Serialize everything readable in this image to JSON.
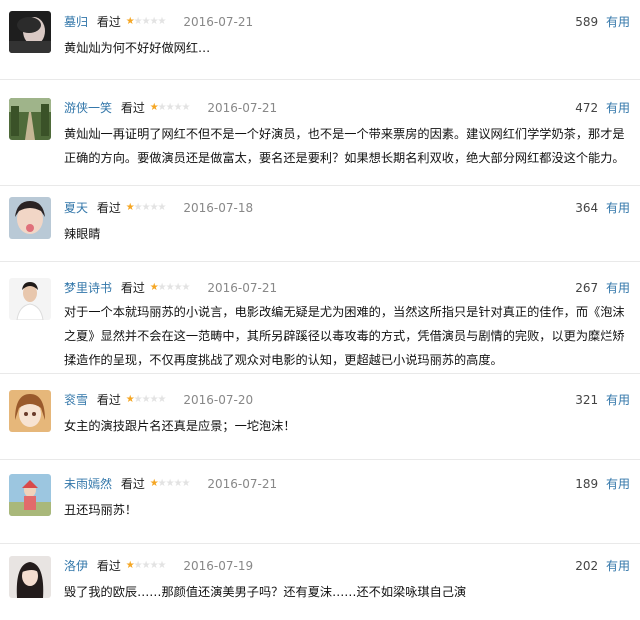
{
  "reviews": [
    {
      "user": "墓归",
      "status": "看过",
      "rating": 1,
      "date": "2016-07-21",
      "votes": "589",
      "useful_label": "有用",
      "avatar_icon": "dark-portrait-avatar",
      "content": "黄灿灿为何不好好做网红…"
    },
    {
      "user": "游侠一笑",
      "status": "看过",
      "rating": 1,
      "date": "2016-07-21",
      "votes": "472",
      "useful_label": "有用",
      "avatar_icon": "forest-road-avatar",
      "content": "黄灿灿一再证明了网红不但不是一个好演员，也不是一个带来票房的因素。建议网红们学学奶茶，那才是正确的方向。要做演员还是做富太，要名还是要利？如果想长期名利双收，绝大部分网红都没这个能力。"
    },
    {
      "user": "夏天",
      "status": "看过",
      "rating": 1,
      "date": "2016-07-18",
      "votes": "364",
      "useful_label": "有用",
      "avatar_icon": "girl-tongue-avatar",
      "content": "辣眼睛"
    },
    {
      "user": "梦里诗书",
      "status": "看过",
      "rating": 1,
      "date": "2016-07-21",
      "votes": "267",
      "useful_label": "有用",
      "avatar_icon": "man-white-shirt-avatar",
      "content": "对于一个本就玛丽苏的小说言，电影改编无疑是尤为困难的，当然这所指只是针对真正的佳作，而《泡沫之夏》显然并不会在这一范畴中，其所另辟蹊径以毒攻毒的方式，凭借演员与剧情的完败，以更为糜烂矫揉造作的呈现，不仅再度挑战了观众对电影的认知，更超越已小说玛丽苏的高度。"
    },
    {
      "user": "衮雪",
      "status": "看过",
      "rating": 1,
      "date": "2016-07-20",
      "votes": "321",
      "useful_label": "有用",
      "avatar_icon": "anime-girl-avatar",
      "content": "女主的演技跟片名还真是应景；一坨泡沫！"
    },
    {
      "user": "未雨嫣然",
      "status": "看过",
      "rating": 1,
      "date": "2016-07-21",
      "votes": "189",
      "useful_label": "有用",
      "avatar_icon": "child-outdoors-avatar",
      "content": "丑还玛丽苏！"
    },
    {
      "user": "洛伊",
      "status": "看过",
      "rating": 1,
      "date": "2016-07-19",
      "votes": "202",
      "useful_label": "有用",
      "avatar_icon": "long-hair-girl-avatar",
      "content": "毁了我的欧辰……那颜值还演美男子吗？还有夏沫……还不如梁咏琪自己演"
    }
  ]
}
